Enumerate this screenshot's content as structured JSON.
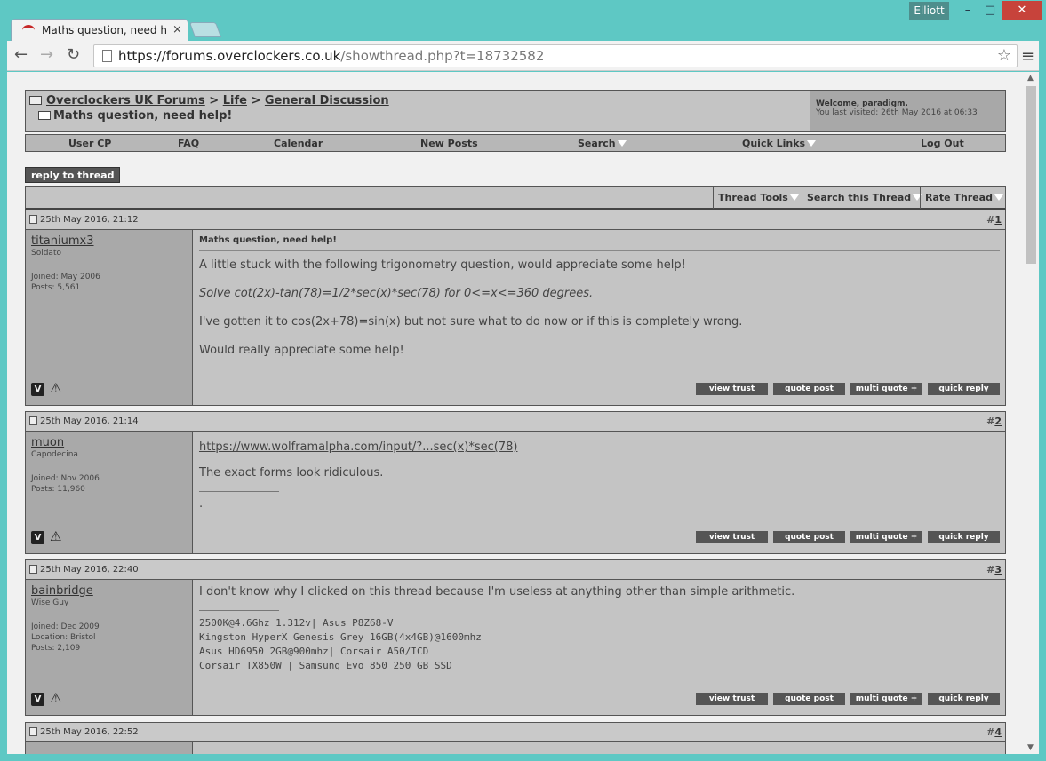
{
  "window": {
    "user": "Elliott",
    "tab_title": "Maths question, need help!",
    "minimize": "–",
    "maximize": "□",
    "close": "✕",
    "tab_close": "×"
  },
  "browser": {
    "url_host": "https://forums.overclockers.co.uk",
    "url_path": "/showthread.php?t=18732582",
    "back_icon": "←",
    "forward_icon": "→",
    "reload_icon": "↻",
    "star_icon": "☆",
    "menu_icon": "≡"
  },
  "header": {
    "forum": "Overclockers UK Forums",
    "sep": ">",
    "section": "Life",
    "subforum": "General Discussion",
    "thread_title": "Maths question, need help!",
    "welcome_label": "Welcome,",
    "username": "paradigm",
    "last_visited": "You last visited: 26th May 2016 at 06:33"
  },
  "navbar": {
    "items": [
      "User CP",
      "FAQ",
      "Calendar",
      "New Posts",
      "Search",
      "Quick Links",
      "Log Out"
    ]
  },
  "reply_button": "reply to thread",
  "thread_tools": [
    "Thread Tools",
    "Search this Thread",
    "Rate Thread"
  ],
  "post_buttons": [
    "view trust",
    "quote post",
    "multi quote +",
    "quick reply"
  ],
  "posts": [
    {
      "date": "25th May 2016, 21:12",
      "num_prefix": "#",
      "num": "1",
      "user": "titaniumx3",
      "title": "Soldato",
      "joined": "Joined: May 2006",
      "location": "",
      "posts": "Posts: 5,561",
      "post_title": "Maths question, need help!",
      "lines": [
        "A little stuck with the following trigonometry question, would appreciate some help!",
        "Solve cot(2x)-tan(78)=1/2*sec(x)*sec(78) for 0<=x<=360 degrees.",
        "I've gotten it to cos(2x+78)=sin(x) but not sure what to do now or if this is completely wrong.",
        "Would really appreciate some help!"
      ]
    },
    {
      "date": "25th May 2016, 21:14",
      "num_prefix": "#",
      "num": "2",
      "user": "muon",
      "title": "Capodecina",
      "joined": "Joined: Nov 2006",
      "posts": "Posts: 11,960",
      "link": "https://www.wolframalpha.com/input/?...sec(x)*sec(78)",
      "line": "The exact forms look ridiculous.",
      "sig": "."
    },
    {
      "date": "25th May 2016, 22:40",
      "num_prefix": "#",
      "num": "3",
      "user": "bainbridge",
      "title": "Wise Guy",
      "joined": "Joined: Dec 2009",
      "location": "Location: Bristol",
      "posts": "Posts: 2,109",
      "line": "I don't know why I clicked on this thread because I'm useless at anything other than simple arithmetic.",
      "sig": [
        "2500K@4.6Ghz 1.312v| Asus P8Z68-V",
        "Kingston HyperX Genesis Grey 16GB(4x4GB)@1600mhz",
        "Asus HD6950 2GB@900mhz| Corsair A50/ICD",
        "Corsair TX850W | Samsung Evo 850 250 GB SSD"
      ]
    },
    {
      "date": "25th May 2016, 22:52",
      "num_prefix": "#",
      "num": "4"
    }
  ]
}
